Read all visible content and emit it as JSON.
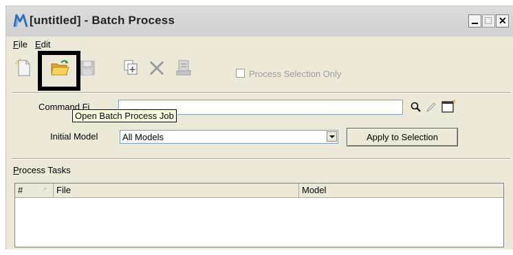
{
  "window": {
    "title": "[untitled] - Batch Process",
    "controls": {
      "minimize": "_",
      "maximize": "□",
      "close": "x"
    }
  },
  "menu": [
    {
      "label_prefix": "",
      "mnemonic": "F",
      "label_rest": "ile"
    },
    {
      "label_prefix": "",
      "mnemonic": "E",
      "label_rest": "dit"
    }
  ],
  "toolbar": {
    "buttons": [
      "new-job-icon",
      "open-folder-icon",
      "save-icon",
      "add-files-icon",
      "delete-icon",
      "process-icon"
    ],
    "process_selection_label": "Process Selection Only",
    "process_selection_checked": false
  },
  "form": {
    "command_file_label": "Command Fi",
    "initial_model_label": "Initial Model",
    "initial_model_value": "All Models",
    "apply_button": "Apply to Selection"
  },
  "tooltip": "Open Batch Process Job",
  "tasks": {
    "section_label_mnemonic": "P",
    "section_label_rest": "rocess Tasks",
    "columns": [
      "#",
      "File",
      "Model"
    ],
    "rows": []
  },
  "colors": {
    "window_bg": "#ece9d8",
    "tooltip_bg": "#ffffe1",
    "folder_yellow": "#f5c542",
    "highlight": "#000000"
  }
}
